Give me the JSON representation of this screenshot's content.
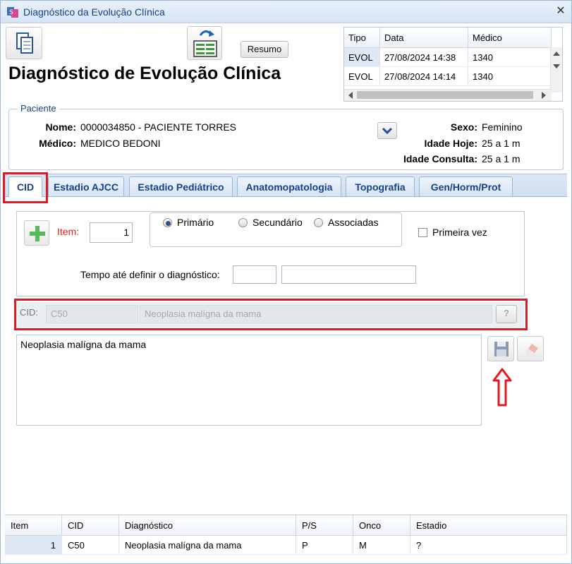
{
  "window": {
    "title": "Diagnóstico da Evolução Clínica",
    "close_glyph": "✕"
  },
  "toolbar": {
    "resumo_label": "Resumo"
  },
  "page_title": "Diagnóstico de Evolução Clínica",
  "history": {
    "columns": [
      "Tipo",
      "Data",
      "Médico"
    ],
    "rows": [
      [
        "EVOL",
        "27/08/2024 14:38",
        "1340"
      ],
      [
        "EVOL",
        "27/08/2024 14:14",
        "1340"
      ]
    ]
  },
  "patient": {
    "legend": "Paciente",
    "nome_label": "Nome:",
    "nome_value": "0000034850 - PACIENTE TORRES",
    "medico_label": "Médico:",
    "medico_value": "MEDICO BEDONI",
    "sexo_label": "Sexo:",
    "sexo_value": "Feminino",
    "idade_hoje_label": "Idade Hoje:",
    "idade_hoje_value": "25 a 1 m",
    "idade_consulta_label": "Idade Consulta:",
    "idade_consulta_value": "25 a 1 m"
  },
  "tabs": [
    "CID",
    "Estadio AJCC",
    "Estadio Pediátrico",
    "Anatomopatologia",
    "Topografia",
    "Gen/Horm/Prot"
  ],
  "form": {
    "item_label": "Item:",
    "item_value": "1",
    "radio_primario": "Primário",
    "radio_secundario": "Secundário",
    "radio_associadas": "Associadas",
    "primeira_vez_label": "Primeira vez",
    "tempo_label": "Tempo até definir o diagnóstico:",
    "cid_label": "CID:",
    "cid_code": "C50",
    "cid_desc": "Neoplasia malígna da mama",
    "help_glyph": "?",
    "description_text": "Neoplasia malígna da mama"
  },
  "grid": {
    "columns": [
      "Item",
      "CID",
      "Diagnóstico",
      "P/S",
      "Onco",
      "Estadio"
    ],
    "rows": [
      [
        "1",
        "C50",
        "Neoplasia malígna da mama",
        "P",
        "M",
        "?"
      ]
    ]
  },
  "colors": {
    "accent": "#15428b",
    "highlight_red": "#e01a22",
    "add_green": "#5cb85c"
  }
}
